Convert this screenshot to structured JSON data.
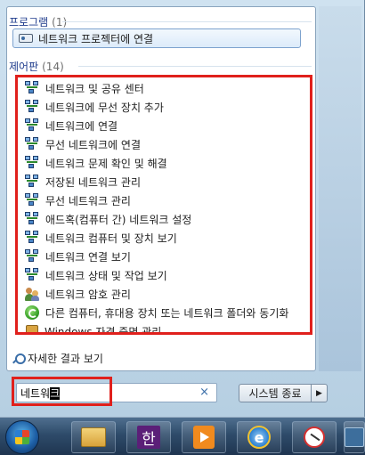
{
  "programs": {
    "header": "프로그램",
    "count": "(1)",
    "items": [
      {
        "label": "네트워크 프로젝터에 연결",
        "icon": "projector-icon"
      }
    ]
  },
  "control_panel": {
    "header": "제어판",
    "count": "(14)",
    "items": [
      {
        "label": "네트워크 및 공유 센터",
        "icon": "network-icon"
      },
      {
        "label": "네트워크에 무선 장치 추가",
        "icon": "network-icon"
      },
      {
        "label": "네트워크에 연결",
        "icon": "network-icon"
      },
      {
        "label": "무선 네트워크에 연결",
        "icon": "network-icon"
      },
      {
        "label": "네트워크 문제 확인 및 해결",
        "icon": "network-icon"
      },
      {
        "label": "저장된 네트워크 관리",
        "icon": "network-icon"
      },
      {
        "label": "무선 네트워크 관리",
        "icon": "network-icon"
      },
      {
        "label": "애드혹(컴퓨터 간) 네트워크 설정",
        "icon": "network-icon"
      },
      {
        "label": "네트워크 컴퓨터 및 장치 보기",
        "icon": "network-icon"
      },
      {
        "label": "네트워크 연결 보기",
        "icon": "network-icon"
      },
      {
        "label": "네트워크 상태 및 작업 보기",
        "icon": "network-icon"
      },
      {
        "label": "네트워크 암호 관리",
        "icon": "users-icon"
      },
      {
        "label": "다른 컴퓨터, 휴대용 장치 또는 네트워크 폴더와 동기화",
        "icon": "sync-icon"
      },
      {
        "label": "Windows 자격 증명 관리",
        "icon": "credential-vault-icon"
      }
    ]
  },
  "see_more": "자세한 결과 보기",
  "search": {
    "value_prefix": "네트워",
    "value_selected": "크",
    "clear": "×"
  },
  "shutdown": {
    "label": "시스템 종료",
    "arrow": "▶"
  },
  "taskbar": {
    "hangul_label": "한",
    "ie_label": "e"
  },
  "colors": {
    "highlight_border": "#e0201c",
    "header_text": "#1e3b8c"
  }
}
